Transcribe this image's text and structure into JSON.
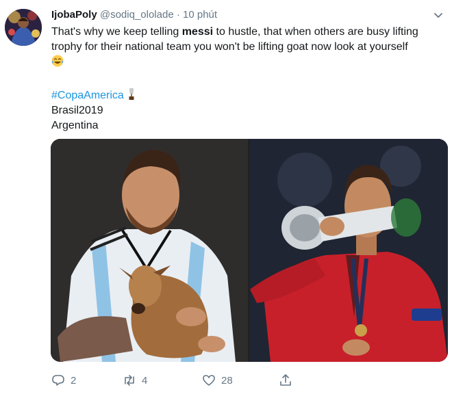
{
  "tweet": {
    "display_name": "IjobaPoly",
    "handle": "@sodiq_ololade",
    "separator": "·",
    "time": "10 phút",
    "text_before": "That's why we keep telling ",
    "text_bold": "messi",
    "text_after": " to hustle, that when others are busy lifting trophy for their national team you won't be lifting goat now look at yourself",
    "emoji": "crying-laughing-emoji",
    "hashtag": "#CopaAmerica",
    "hashtag_emoji": "trophy-emoji",
    "line2": "Brasil2019",
    "line3": "Argentina",
    "replies": "2",
    "retweets": "4",
    "likes": "28"
  },
  "media": {
    "left_image": "player-in-argentina-shirt-holding-goat",
    "right_image": "player-in-portugal-shirt-holding-trophy"
  },
  "colors": {
    "accent": "#1b95e0",
    "text": "#14171a",
    "secondary": "#657786"
  }
}
